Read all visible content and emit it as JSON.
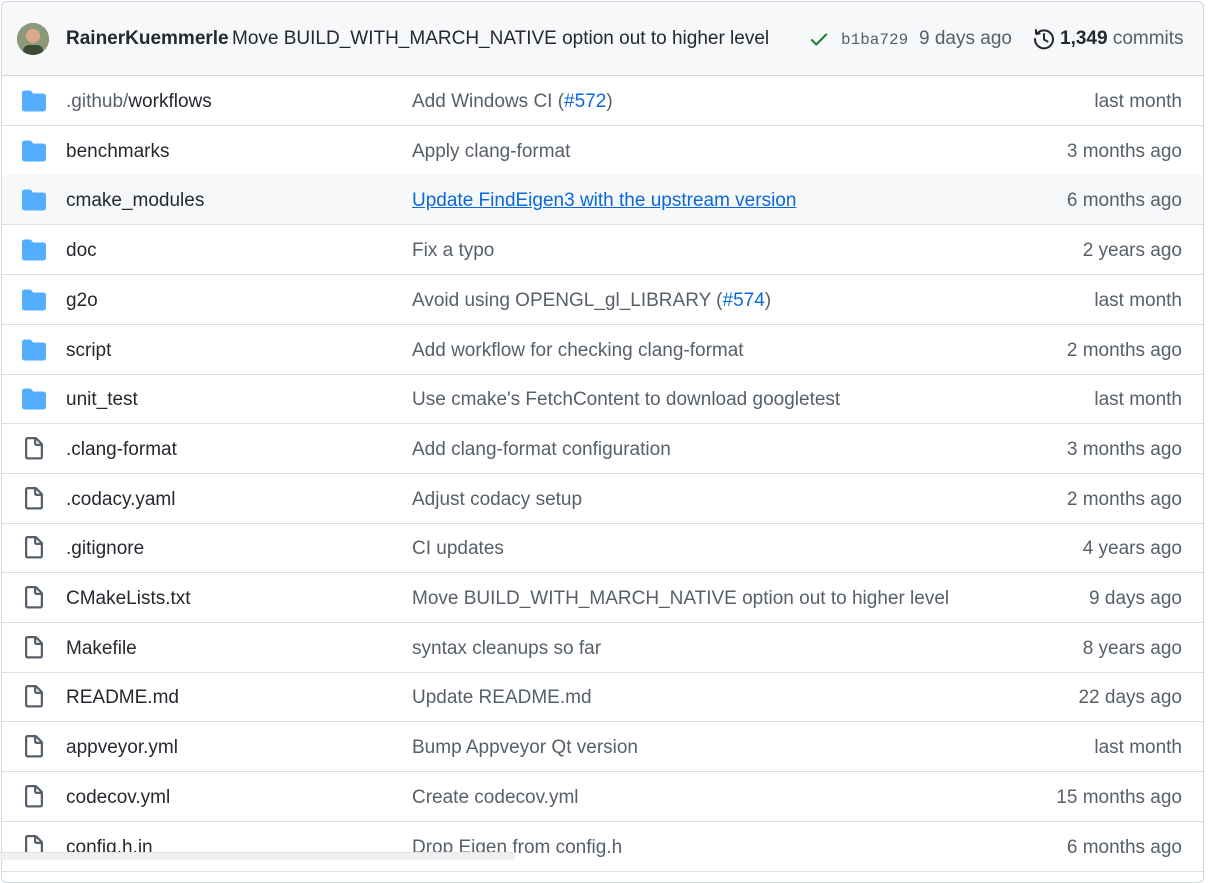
{
  "commit": {
    "author": "RainerKuemmerle",
    "message": "Move BUILD_WITH_MARCH_NATIVE option out to higher level",
    "sha": "b1ba729",
    "when": "9 days ago",
    "commit_count": "1,349",
    "commit_label": "commits",
    "status_color": "#1a7f37"
  },
  "colors": {
    "folder": "#54aeff",
    "file": "#57606a",
    "link": "#0969da"
  },
  "rows": [
    {
      "type": "folder",
      "name_prefix": ".github/",
      "name": "workflows",
      "msg": "Add Windows CI (",
      "pr": "#572",
      "msg_suffix": ")",
      "age": "last month"
    },
    {
      "type": "folder",
      "name_prefix": "",
      "name": "benchmarks",
      "msg": "Apply clang-format",
      "pr": "",
      "msg_suffix": "",
      "age": "3 months ago"
    },
    {
      "type": "folder",
      "name_prefix": "",
      "name": "cmake_modules",
      "msg": "Update FindEigen3 with the upstream version",
      "pr": "",
      "msg_suffix": "",
      "age": "6 months ago",
      "hover": true
    },
    {
      "type": "folder",
      "name_prefix": "",
      "name": "doc",
      "msg": "Fix a typo",
      "pr": "",
      "msg_suffix": "",
      "age": "2 years ago"
    },
    {
      "type": "folder",
      "name_prefix": "",
      "name": "g2o",
      "msg": "Avoid using OPENGL_gl_LIBRARY (",
      "pr": "#574",
      "msg_suffix": ")",
      "age": "last month"
    },
    {
      "type": "folder",
      "name_prefix": "",
      "name": "script",
      "msg": "Add workflow for checking clang-format",
      "pr": "",
      "msg_suffix": "",
      "age": "2 months ago"
    },
    {
      "type": "folder",
      "name_prefix": "",
      "name": "unit_test",
      "msg": "Use cmake's FetchContent to download googletest",
      "pr": "",
      "msg_suffix": "",
      "age": "last month"
    },
    {
      "type": "file",
      "name_prefix": "",
      "name": ".clang-format",
      "msg": "Add clang-format configuration",
      "pr": "",
      "msg_suffix": "",
      "age": "3 months ago"
    },
    {
      "type": "file",
      "name_prefix": "",
      "name": ".codacy.yaml",
      "msg": "Adjust codacy setup",
      "pr": "",
      "msg_suffix": "",
      "age": "2 months ago"
    },
    {
      "type": "file",
      "name_prefix": "",
      "name": ".gitignore",
      "msg": "CI updates",
      "pr": "",
      "msg_suffix": "",
      "age": "4 years ago"
    },
    {
      "type": "file",
      "name_prefix": "",
      "name": "CMakeLists.txt",
      "msg": "Move BUILD_WITH_MARCH_NATIVE option out to higher level",
      "pr": "",
      "msg_suffix": "",
      "age": "9 days ago"
    },
    {
      "type": "file",
      "name_prefix": "",
      "name": "Makefile",
      "msg": "syntax cleanups so far",
      "pr": "",
      "msg_suffix": "",
      "age": "8 years ago"
    },
    {
      "type": "file",
      "name_prefix": "",
      "name": "README.md",
      "msg": "Update README.md",
      "pr": "",
      "msg_suffix": "",
      "age": "22 days ago"
    },
    {
      "type": "file",
      "name_prefix": "",
      "name": "appveyor.yml",
      "msg": "Bump Appveyor Qt version",
      "pr": "",
      "msg_suffix": "",
      "age": "last month"
    },
    {
      "type": "file",
      "name_prefix": "",
      "name": "codecov.yml",
      "msg": "Create codecov.yml",
      "pr": "",
      "msg_suffix": "",
      "age": "15 months ago"
    },
    {
      "type": "file",
      "name_prefix": "",
      "name": "config.h.in",
      "msg": "Drop Eigen from config.h",
      "pr": "",
      "msg_suffix": "",
      "age": "6 months ago"
    }
  ]
}
